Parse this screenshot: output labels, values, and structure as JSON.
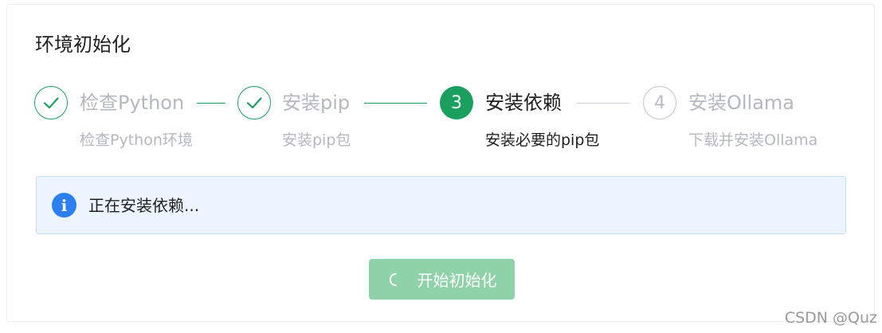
{
  "card": {
    "title": "环境初始化"
  },
  "steps": [
    {
      "index": "1",
      "title": "检查Python",
      "description": "检查Python环境",
      "status": "done"
    },
    {
      "index": "2",
      "title": "安装pip",
      "description": "安装pip包",
      "status": "done"
    },
    {
      "index": "3",
      "title": "安装依赖",
      "description": "安装必要的pip包",
      "status": "active"
    },
    {
      "index": "4",
      "title": "安装Ollama",
      "description": "下载并安装Ollama",
      "status": "wait"
    }
  ],
  "alert": {
    "icon": "info-icon",
    "text": "正在安装依赖..."
  },
  "start_button": {
    "label": "开始初始化",
    "loading": true,
    "disabled": true
  },
  "colors": {
    "success": "#1a9f5e",
    "wait": "#c0c4cc",
    "info": "#2b7ff0",
    "button_disabled": "#8fd1a9"
  },
  "watermark": "CSDN @Quz"
}
